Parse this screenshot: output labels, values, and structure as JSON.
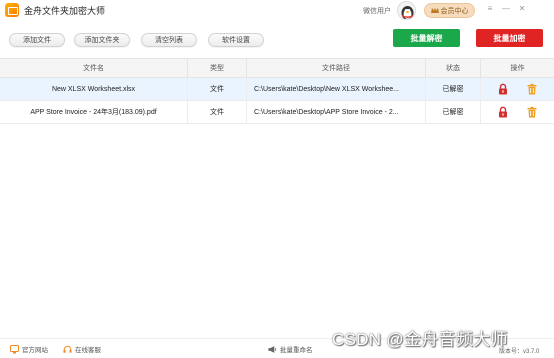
{
  "titlebar": {
    "app_title": "金舟文件夹加密大师",
    "user_label": "微信用户",
    "member_label": "会员中心",
    "controls": {
      "menu": "≡",
      "minimize": "—",
      "close": "✕"
    }
  },
  "toolbar": {
    "add_file": "添加文件",
    "add_folder": "添加文件夹",
    "clear_list": "清空列表",
    "settings": "软件设置",
    "batch_decrypt": "批量解密",
    "batch_encrypt": "批量加密"
  },
  "table": {
    "columns": [
      "文件名",
      "类型",
      "文件路径",
      "状态",
      "操作"
    ],
    "rows": [
      {
        "name": "New XLSX Worksheet.xlsx",
        "type": "文件",
        "path": "C:\\Users\\kate\\Desktop\\New XLSX Workshee...",
        "status": "已解密"
      },
      {
        "name": "APP Store Invoice - 24年3月(183.09).pdf",
        "type": "文件",
        "path": "C:\\Users\\kate\\Desktop\\APP Store Invoice - 2...",
        "status": "已解密"
      }
    ]
  },
  "footer": {
    "website": "官方网站",
    "support": "在线客服",
    "batch_rename": "批量重命名",
    "version": "版本号：v3.7.0",
    "watermark": "CSDN @金舟音频大师"
  },
  "colors": {
    "decrypt_green": "#1aa84a",
    "encrypt_red": "#e02424",
    "lock_red": "#d32f2f",
    "trash_orange": "#f0a020",
    "selected_row": "#eaf4fe",
    "member_gold": "#f6dcbd"
  },
  "icons": {
    "logo": "folder-lock-logo",
    "avatar": "penguin-avatar",
    "member": "crown-icon",
    "row_actions": [
      "lock-icon",
      "trash-icon"
    ],
    "footer": [
      "home-icon",
      "headset-icon",
      "megaphone-icon"
    ]
  }
}
